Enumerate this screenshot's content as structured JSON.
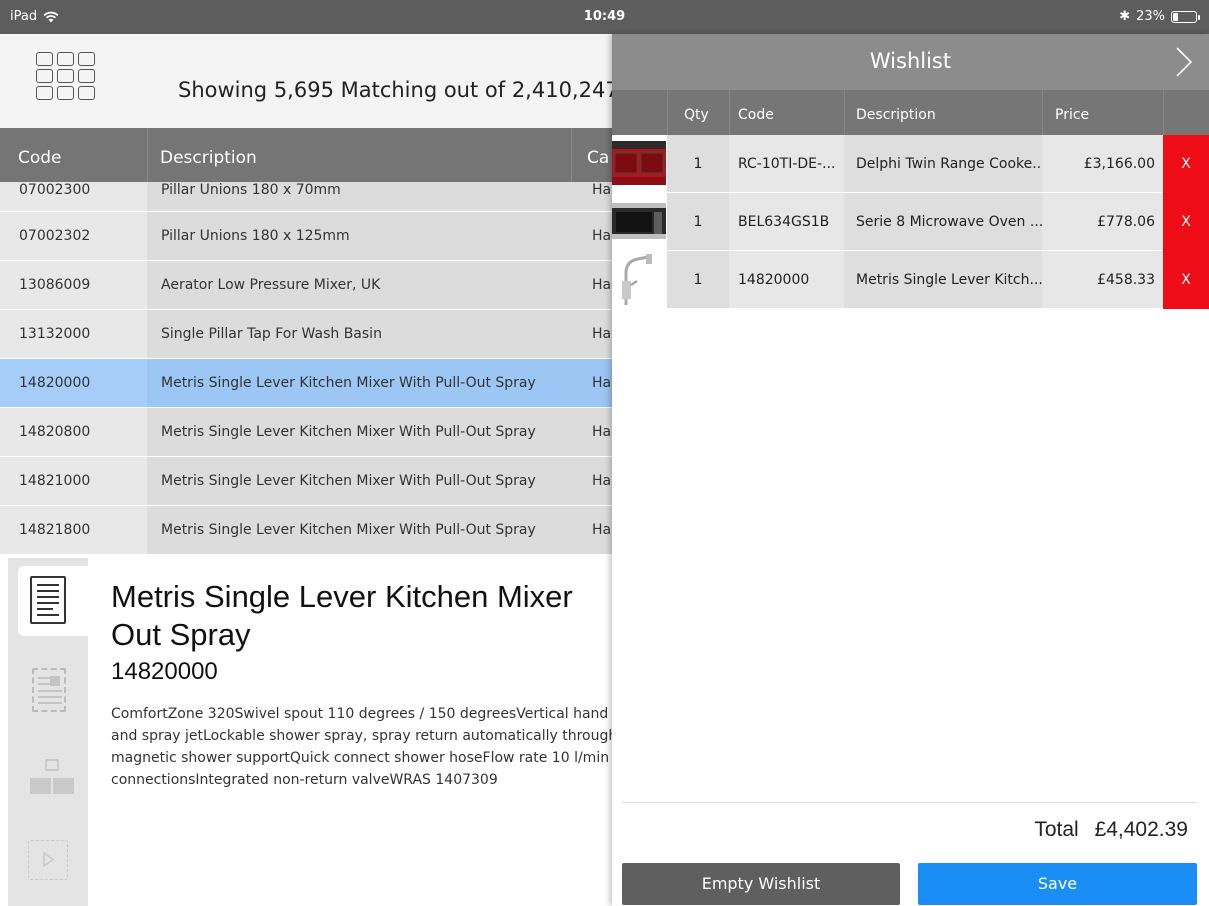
{
  "status_bar": {
    "device": "iPad",
    "time": "10:49",
    "bluetooth": "✱",
    "battery_text": "23%",
    "battery_level": 0.23
  },
  "catalog": {
    "match_text": "Showing 5,695 Matching out of 2,410,247",
    "columns": {
      "code": "Code",
      "description": "Description",
      "category": "Ca"
    },
    "rows": [
      {
        "code": "07002300",
        "description": "Pillar Unions 180 x 70mm",
        "category": "Ha"
      },
      {
        "code": "07002302",
        "description": "Pillar Unions 180 x 125mm",
        "category": "Ha"
      },
      {
        "code": "13086009",
        "description": "Aerator Low Pressure Mixer, UK",
        "category": "Ha"
      },
      {
        "code": "13132000",
        "description": "Single Pillar Tap For Wash Basin",
        "category": "Ha"
      },
      {
        "code": "14820000",
        "description": "Metris Single Lever Kitchen Mixer With Pull-Out Spray",
        "category": "Ha"
      },
      {
        "code": "14820800",
        "description": "Metris Single Lever Kitchen Mixer With Pull-Out Spray",
        "category": "Ha"
      },
      {
        "code": "14821000",
        "description": "Metris Single Lever Kitchen Mixer With Pull-Out Spray",
        "category": "Ha"
      },
      {
        "code": "14821800",
        "description": "Metris Single Lever Kitchen Mixer With Pull-Out Spray",
        "category": "Ha"
      }
    ],
    "selected_index": 4
  },
  "detail": {
    "title_line1": "Metris Single Lever Kitchen Mixer",
    "title_line2": "Out Spray",
    "code": "14820000",
    "description_line1": "ComfortZone 320Swivel spout 110 degrees / 150 degreesVertical hand",
    "description_line2": "and spray jetLockable shower spray, spray return automatically through",
    "description_line3": "magnetic shower supportQuick connect shower hoseFlow rate 10 l/min",
    "description_line4": "connectionsIntegrated non-return valveWRAS 1407309"
  },
  "wishlist": {
    "title": "Wishlist",
    "columns": {
      "qty": "Qty",
      "code": "Code",
      "description": "Description",
      "price": "Price"
    },
    "items": [
      {
        "qty": "1",
        "code": "RC-10TI-DE-...",
        "description": "Delphi Twin Range Cooke...",
        "price": "£3,166.00",
        "delete": "X",
        "thumb": "range-cooker-thumbnail"
      },
      {
        "qty": "1",
        "code": "BEL634GS1B",
        "description": "Serie 8 Microwave Oven ...",
        "price": "£778.06",
        "delete": "X",
        "thumb": "microwave-thumbnail"
      },
      {
        "qty": "1",
        "code": "14820000",
        "description": "Metris Single Lever Kitch...",
        "price": "£458.33",
        "delete": "X",
        "thumb": "kitchen-mixer-thumbnail"
      }
    ],
    "total_label": "Total",
    "total_value": "£4,402.39",
    "empty_button": "Empty Wishlist",
    "save_button": "Save"
  },
  "colors": {
    "selected_row": "#9cc6f4",
    "delete_red": "#ee0d17",
    "save_blue": "#1a8ef4",
    "header_gray": "#767676"
  }
}
